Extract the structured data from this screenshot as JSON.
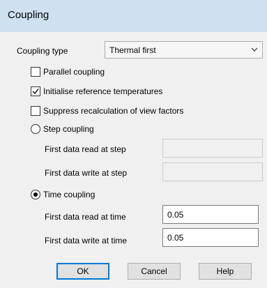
{
  "window": {
    "title": "Coupling"
  },
  "coupling_type": {
    "label": "Coupling type",
    "value": "Thermal first"
  },
  "checkboxes": [
    {
      "label": "Parallel coupling",
      "checked": false
    },
    {
      "label": "Initialise reference temperatures",
      "checked": true
    },
    {
      "label": "Suppress recalculation of view factors",
      "checked": false
    }
  ],
  "step_coupling": {
    "label": "Step coupling",
    "selected": false,
    "read_label": "First data read at step",
    "read_value": "",
    "write_label": "First data write at step",
    "write_value": ""
  },
  "time_coupling": {
    "label": "Time coupling",
    "selected": true,
    "read_label": "First data read at time",
    "read_value": "0.05",
    "write_label": "First data write at time",
    "write_value": "0.05"
  },
  "buttons": {
    "ok": "OK",
    "cancel": "Cancel",
    "help": "Help"
  },
  "colors": {
    "title_bar": "#cfe0f0",
    "dialog_bg": "#f0f0f0",
    "default_button_border": "#0078d7"
  }
}
